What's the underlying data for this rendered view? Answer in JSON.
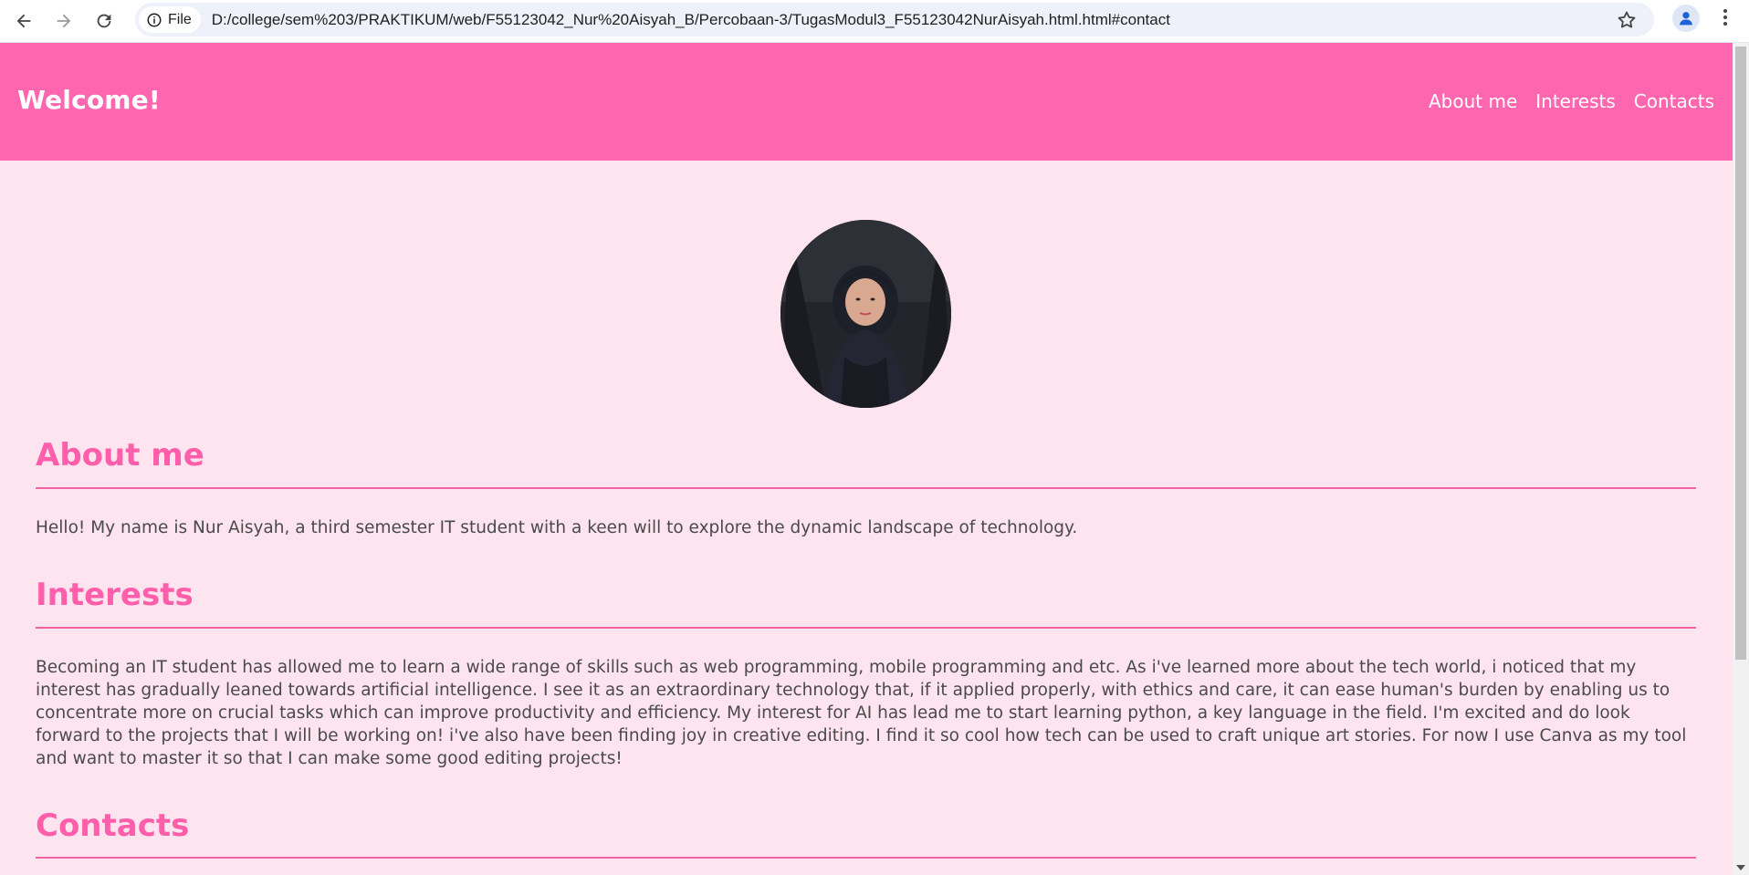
{
  "browser": {
    "back_icon": "arrow-left-icon",
    "forward_icon": "arrow-right-icon",
    "reload_icon": "reload-icon",
    "site_info_label": "File",
    "url": "D:/college/sem%203/PRAKTIKUM/web/F55123042_Nur%20Aisyah_B/Percobaan-3/TugasModul3_F55123042NurAisyah.html.html#contact",
    "bookmark_icon": "star-icon",
    "profile_icon": "person-icon",
    "menu_icon": "kebab-menu-icon"
  },
  "header": {
    "brand": "Welcome!",
    "nav": [
      "About me",
      "Interests",
      "Contacts"
    ],
    "bg_color": "#ff66b0"
  },
  "profile_photo": {
    "icon": "profile-photo"
  },
  "sections": {
    "about": {
      "title": "About me",
      "text": "Hello! My name is Nur Aisyah, a third semester IT student with a keen will to explore the dynamic landscape of technology."
    },
    "interests": {
      "title": "Interests",
      "text": "Becoming an IT student has allowed me to learn a wide range of skills such as web programming, mobile programming and etc. As i've learned more about the tech world, i noticed that my interest has gradually leaned towards artificial intelligence. I see it as an extraordinary technology that, if it applied properly, with ethics and care, it can ease human's burden by enabling us to concentrate more on crucial tasks which can improve productivity and efficiency. My interest for AI has lead me to start learning python, a key language in the field. I'm excited and do look forward to the projects that I will be working on! i've also have been finding joy in creative editing. I find it so cool how tech can be used to craft unique art stories. For now I use Canva as my tool and want to master it so that I can make some good editing projects!"
    },
    "contacts": {
      "title": "Contacts"
    }
  },
  "colors": {
    "page_bg": "#fde4ef",
    "accent": "#ff5eab",
    "text": "#4a4a4a"
  }
}
